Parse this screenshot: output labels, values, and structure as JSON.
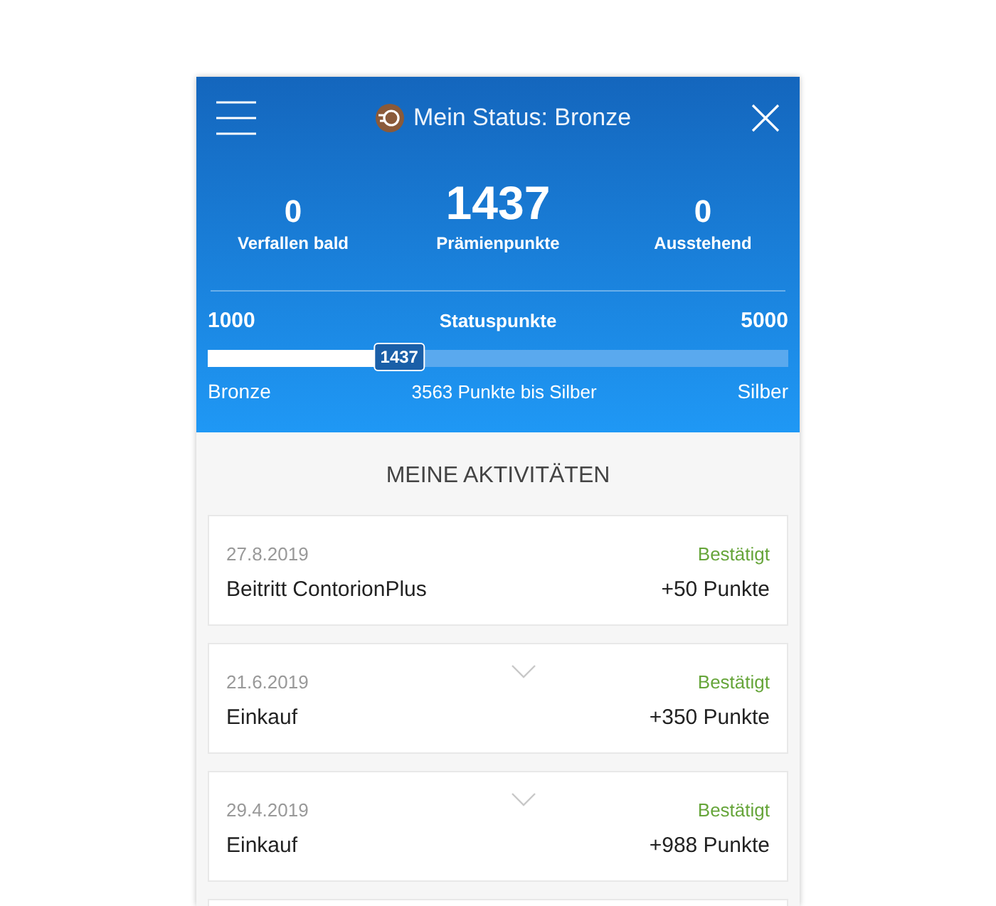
{
  "header": {
    "title": "Mein Status: Bronze"
  },
  "stats": [
    {
      "value": "0",
      "label": "Verfallen bald",
      "kind": "small"
    },
    {
      "value": "1437",
      "label": "Prämienpunkte",
      "kind": "main"
    },
    {
      "value": "0",
      "label": "Ausstehend",
      "kind": "small"
    }
  ],
  "status": {
    "min": "1000",
    "title": "Statuspunkte",
    "max": "5000",
    "level": 0.33,
    "current": "1437",
    "from": "Bronze",
    "remaining": "3563 Punkte bis Silber",
    "to": "Silber"
  },
  "activities_title": "MEINE AKTIVITÄTEN",
  "activities": [
    {
      "date": "27.8.2019",
      "status": "Bestätigt",
      "name": "Beitritt ContorionPlus",
      "points": "+50 Punkte",
      "expandable": false
    },
    {
      "date": "21.6.2019",
      "status": "Bestätigt",
      "name": "Einkauf",
      "points": "+350 Punkte",
      "expandable": true
    },
    {
      "date": "29.4.2019",
      "status": "Bestätigt",
      "name": "Einkauf",
      "points": "+988 Punkte",
      "expandable": true
    }
  ]
}
